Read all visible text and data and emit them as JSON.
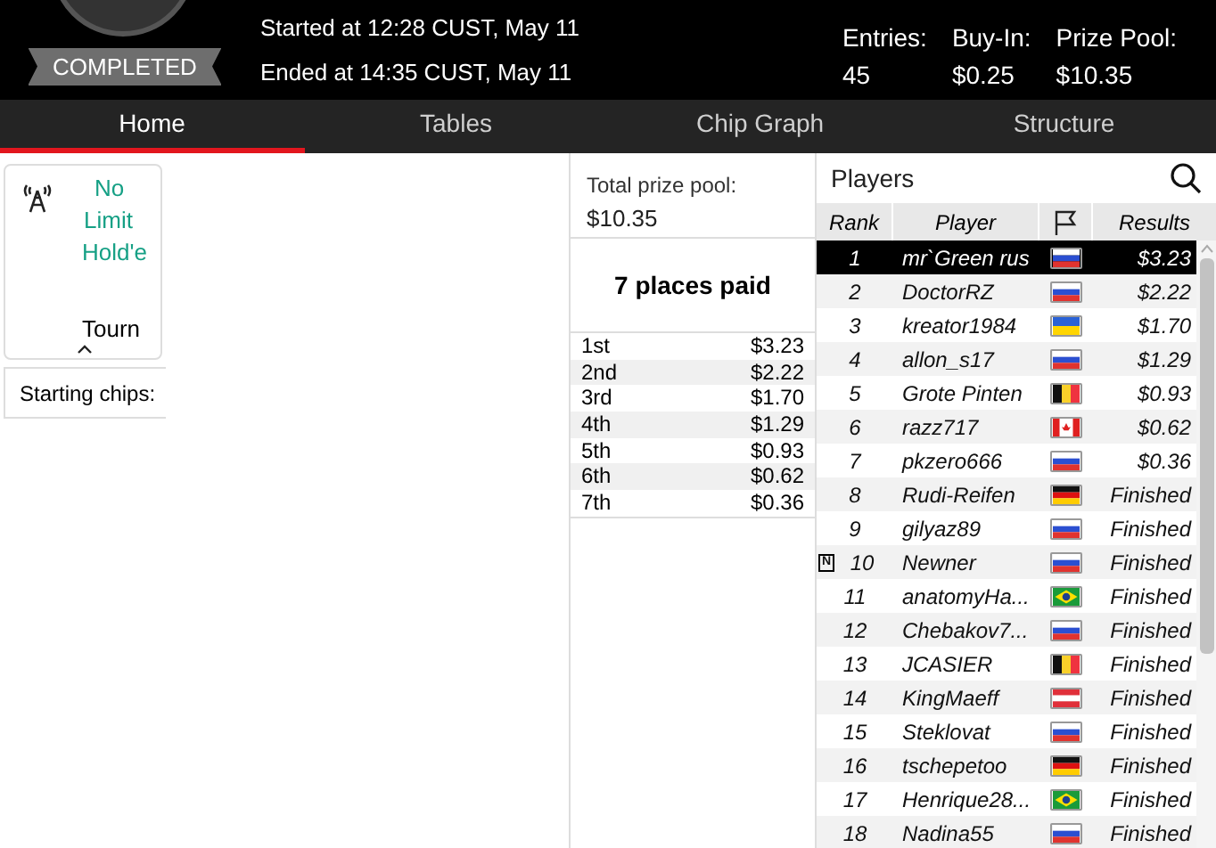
{
  "header": {
    "status": "COMPLETED",
    "started": "Started at 12:28 CUST, May 11",
    "ended": "Ended at 14:35 CUST, May 11",
    "stats": [
      {
        "label": "Entries:",
        "value": "45"
      },
      {
        "label": "Buy-In:",
        "value": "$0.25"
      },
      {
        "label": "Prize Pool:",
        "value": "$10.35"
      }
    ]
  },
  "tabs": [
    {
      "label": "Home",
      "selected": true
    },
    {
      "label": "Tables",
      "selected": false
    },
    {
      "label": "Chip Graph",
      "selected": false
    },
    {
      "label": "Structure",
      "selected": false
    }
  ],
  "info_card": {
    "game": [
      "No",
      "Limit",
      "Hold'e"
    ],
    "type": "Tourn"
  },
  "starting_chips": {
    "label": "Starting chips:"
  },
  "prize": {
    "label": "Total prize pool:",
    "value": "$10.35",
    "places": "7 places paid",
    "payouts": [
      {
        "place": "1st",
        "amount": "$3.23"
      },
      {
        "place": "2nd",
        "amount": "$2.22"
      },
      {
        "place": "3rd",
        "amount": "$1.70"
      },
      {
        "place": "4th",
        "amount": "$1.29"
      },
      {
        "place": "5th",
        "amount": "$0.93"
      },
      {
        "place": "6th",
        "amount": "$0.62"
      },
      {
        "place": "7th",
        "amount": "$0.36"
      }
    ]
  },
  "players": {
    "title": "Players",
    "columns": [
      "Rank",
      "Player",
      "Results"
    ],
    "rows": [
      {
        "rank": "1",
        "name": "mr`Green rus",
        "kind": "ru",
        "result": "$3.23",
        "selected": true
      },
      {
        "rank": "2",
        "name": "DoctorRZ",
        "kind": "ru",
        "result": "$2.22",
        "selected": false
      },
      {
        "rank": "3",
        "name": "kreator1984",
        "kind": "ua",
        "result": "$1.70",
        "selected": false
      },
      {
        "rank": "4",
        "name": "allon_s17",
        "kind": "ru",
        "result": "$1.29",
        "selected": false
      },
      {
        "rank": "5",
        "name": "Grote Pinten",
        "kind": "be",
        "result": "$0.93",
        "selected": false
      },
      {
        "rank": "6",
        "name": "razz717",
        "kind": "ca",
        "result": "$0.62",
        "selected": false
      },
      {
        "rank": "7",
        "name": "pkzero666",
        "kind": "ru",
        "result": "$0.36",
        "selected": false
      },
      {
        "rank": "8",
        "name": "Rudi-Reifen",
        "kind": "de",
        "result": "Finished",
        "selected": false
      },
      {
        "rank": "9",
        "name": "gilyaz89",
        "kind": "ru",
        "result": "Finished",
        "selected": false
      },
      {
        "rank": "10",
        "name": "Newner",
        "kind": "ru",
        "result": "Finished",
        "selected": false,
        "badge": "N"
      },
      {
        "rank": "11",
        "name": "anatomyHa...",
        "kind": "br",
        "result": "Finished",
        "selected": false
      },
      {
        "rank": "12",
        "name": "Chebakov7...",
        "kind": "ru",
        "result": "Finished",
        "selected": false
      },
      {
        "rank": "13",
        "name": "JCASIER",
        "kind": "be",
        "result": "Finished",
        "selected": false
      },
      {
        "rank": "14",
        "name": "KingMaeff",
        "kind": "at",
        "result": "Finished",
        "selected": false
      },
      {
        "rank": "15",
        "name": "Steklovat",
        "kind": "ru",
        "result": "Finished",
        "selected": false
      },
      {
        "rank": "16",
        "name": "tschepetoo",
        "kind": "de",
        "result": "Finished",
        "selected": false
      },
      {
        "rank": "17",
        "name": "Henrique28...",
        "kind": "br",
        "result": "Finished",
        "selected": false
      },
      {
        "rank": "18",
        "name": "Nadina55",
        "kind": "ru",
        "result": "Finished",
        "selected": false
      }
    ]
  }
}
